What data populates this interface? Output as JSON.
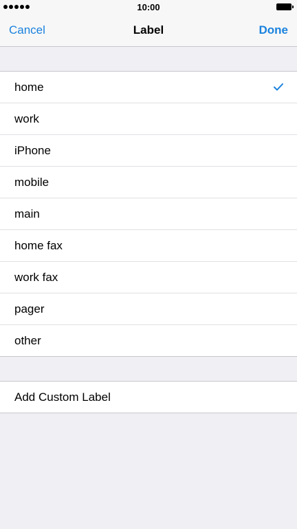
{
  "status_bar": {
    "time": "10:00",
    "signal_dots": 5
  },
  "nav": {
    "cancel_label": "Cancel",
    "title": "Label",
    "done_label": "Done"
  },
  "labels": {
    "selected": "home",
    "items": [
      {
        "label": "home"
      },
      {
        "label": "work"
      },
      {
        "label": "iPhone"
      },
      {
        "label": "mobile"
      },
      {
        "label": "main"
      },
      {
        "label": "home fax"
      },
      {
        "label": "work fax"
      },
      {
        "label": "pager"
      },
      {
        "label": "other"
      }
    ]
  },
  "custom": {
    "add_label": "Add Custom Label"
  },
  "colors": {
    "accent": "#1a82de",
    "background": "#efeff4",
    "separator": "#c8c7cc"
  },
  "icons": {
    "selected_marker": "checkmark-icon",
    "battery": "battery-icon",
    "signal": "signal-strength-icon"
  }
}
